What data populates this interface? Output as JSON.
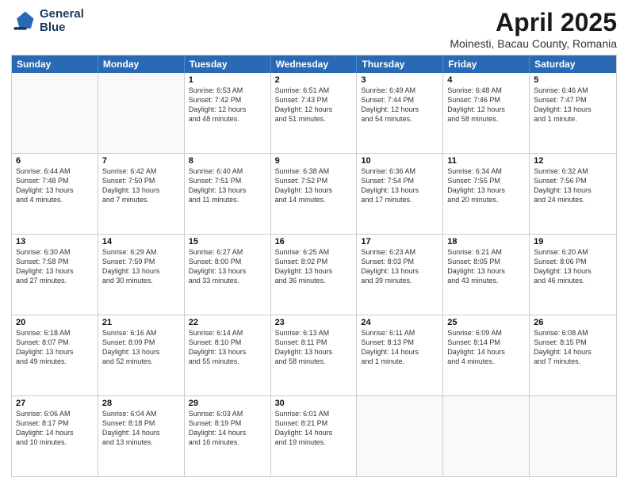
{
  "logo": {
    "line1": "General",
    "line2": "Blue"
  },
  "title": "April 2025",
  "subtitle": "Moinesti, Bacau County, Romania",
  "header_days": [
    "Sunday",
    "Monday",
    "Tuesday",
    "Wednesday",
    "Thursday",
    "Friday",
    "Saturday"
  ],
  "weeks": [
    [
      {
        "day": "",
        "lines": []
      },
      {
        "day": "",
        "lines": []
      },
      {
        "day": "1",
        "lines": [
          "Sunrise: 6:53 AM",
          "Sunset: 7:42 PM",
          "Daylight: 12 hours",
          "and 48 minutes."
        ]
      },
      {
        "day": "2",
        "lines": [
          "Sunrise: 6:51 AM",
          "Sunset: 7:43 PM",
          "Daylight: 12 hours",
          "and 51 minutes."
        ]
      },
      {
        "day": "3",
        "lines": [
          "Sunrise: 6:49 AM",
          "Sunset: 7:44 PM",
          "Daylight: 12 hours",
          "and 54 minutes."
        ]
      },
      {
        "day": "4",
        "lines": [
          "Sunrise: 6:48 AM",
          "Sunset: 7:46 PM",
          "Daylight: 12 hours",
          "and 58 minutes."
        ]
      },
      {
        "day": "5",
        "lines": [
          "Sunrise: 6:46 AM",
          "Sunset: 7:47 PM",
          "Daylight: 13 hours",
          "and 1 minute."
        ]
      }
    ],
    [
      {
        "day": "6",
        "lines": [
          "Sunrise: 6:44 AM",
          "Sunset: 7:48 PM",
          "Daylight: 13 hours",
          "and 4 minutes."
        ]
      },
      {
        "day": "7",
        "lines": [
          "Sunrise: 6:42 AM",
          "Sunset: 7:50 PM",
          "Daylight: 13 hours",
          "and 7 minutes."
        ]
      },
      {
        "day": "8",
        "lines": [
          "Sunrise: 6:40 AM",
          "Sunset: 7:51 PM",
          "Daylight: 13 hours",
          "and 11 minutes."
        ]
      },
      {
        "day": "9",
        "lines": [
          "Sunrise: 6:38 AM",
          "Sunset: 7:52 PM",
          "Daylight: 13 hours",
          "and 14 minutes."
        ]
      },
      {
        "day": "10",
        "lines": [
          "Sunrise: 6:36 AM",
          "Sunset: 7:54 PM",
          "Daylight: 13 hours",
          "and 17 minutes."
        ]
      },
      {
        "day": "11",
        "lines": [
          "Sunrise: 6:34 AM",
          "Sunset: 7:55 PM",
          "Daylight: 13 hours",
          "and 20 minutes."
        ]
      },
      {
        "day": "12",
        "lines": [
          "Sunrise: 6:32 AM",
          "Sunset: 7:56 PM",
          "Daylight: 13 hours",
          "and 24 minutes."
        ]
      }
    ],
    [
      {
        "day": "13",
        "lines": [
          "Sunrise: 6:30 AM",
          "Sunset: 7:58 PM",
          "Daylight: 13 hours",
          "and 27 minutes."
        ]
      },
      {
        "day": "14",
        "lines": [
          "Sunrise: 6:29 AM",
          "Sunset: 7:59 PM",
          "Daylight: 13 hours",
          "and 30 minutes."
        ]
      },
      {
        "day": "15",
        "lines": [
          "Sunrise: 6:27 AM",
          "Sunset: 8:00 PM",
          "Daylight: 13 hours",
          "and 33 minutes."
        ]
      },
      {
        "day": "16",
        "lines": [
          "Sunrise: 6:25 AM",
          "Sunset: 8:02 PM",
          "Daylight: 13 hours",
          "and 36 minutes."
        ]
      },
      {
        "day": "17",
        "lines": [
          "Sunrise: 6:23 AM",
          "Sunset: 8:03 PM",
          "Daylight: 13 hours",
          "and 39 minutes."
        ]
      },
      {
        "day": "18",
        "lines": [
          "Sunrise: 6:21 AM",
          "Sunset: 8:05 PM",
          "Daylight: 13 hours",
          "and 43 minutes."
        ]
      },
      {
        "day": "19",
        "lines": [
          "Sunrise: 6:20 AM",
          "Sunset: 8:06 PM",
          "Daylight: 13 hours",
          "and 46 minutes."
        ]
      }
    ],
    [
      {
        "day": "20",
        "lines": [
          "Sunrise: 6:18 AM",
          "Sunset: 8:07 PM",
          "Daylight: 13 hours",
          "and 49 minutes."
        ]
      },
      {
        "day": "21",
        "lines": [
          "Sunrise: 6:16 AM",
          "Sunset: 8:09 PM",
          "Daylight: 13 hours",
          "and 52 minutes."
        ]
      },
      {
        "day": "22",
        "lines": [
          "Sunrise: 6:14 AM",
          "Sunset: 8:10 PM",
          "Daylight: 13 hours",
          "and 55 minutes."
        ]
      },
      {
        "day": "23",
        "lines": [
          "Sunrise: 6:13 AM",
          "Sunset: 8:11 PM",
          "Daylight: 13 hours",
          "and 58 minutes."
        ]
      },
      {
        "day": "24",
        "lines": [
          "Sunrise: 6:11 AM",
          "Sunset: 8:13 PM",
          "Daylight: 14 hours",
          "and 1 minute."
        ]
      },
      {
        "day": "25",
        "lines": [
          "Sunrise: 6:09 AM",
          "Sunset: 8:14 PM",
          "Daylight: 14 hours",
          "and 4 minutes."
        ]
      },
      {
        "day": "26",
        "lines": [
          "Sunrise: 6:08 AM",
          "Sunset: 8:15 PM",
          "Daylight: 14 hours",
          "and 7 minutes."
        ]
      }
    ],
    [
      {
        "day": "27",
        "lines": [
          "Sunrise: 6:06 AM",
          "Sunset: 8:17 PM",
          "Daylight: 14 hours",
          "and 10 minutes."
        ]
      },
      {
        "day": "28",
        "lines": [
          "Sunrise: 6:04 AM",
          "Sunset: 8:18 PM",
          "Daylight: 14 hours",
          "and 13 minutes."
        ]
      },
      {
        "day": "29",
        "lines": [
          "Sunrise: 6:03 AM",
          "Sunset: 8:19 PM",
          "Daylight: 14 hours",
          "and 16 minutes."
        ]
      },
      {
        "day": "30",
        "lines": [
          "Sunrise: 6:01 AM",
          "Sunset: 8:21 PM",
          "Daylight: 14 hours",
          "and 19 minutes."
        ]
      },
      {
        "day": "",
        "lines": []
      },
      {
        "day": "",
        "lines": []
      },
      {
        "day": "",
        "lines": []
      }
    ]
  ]
}
